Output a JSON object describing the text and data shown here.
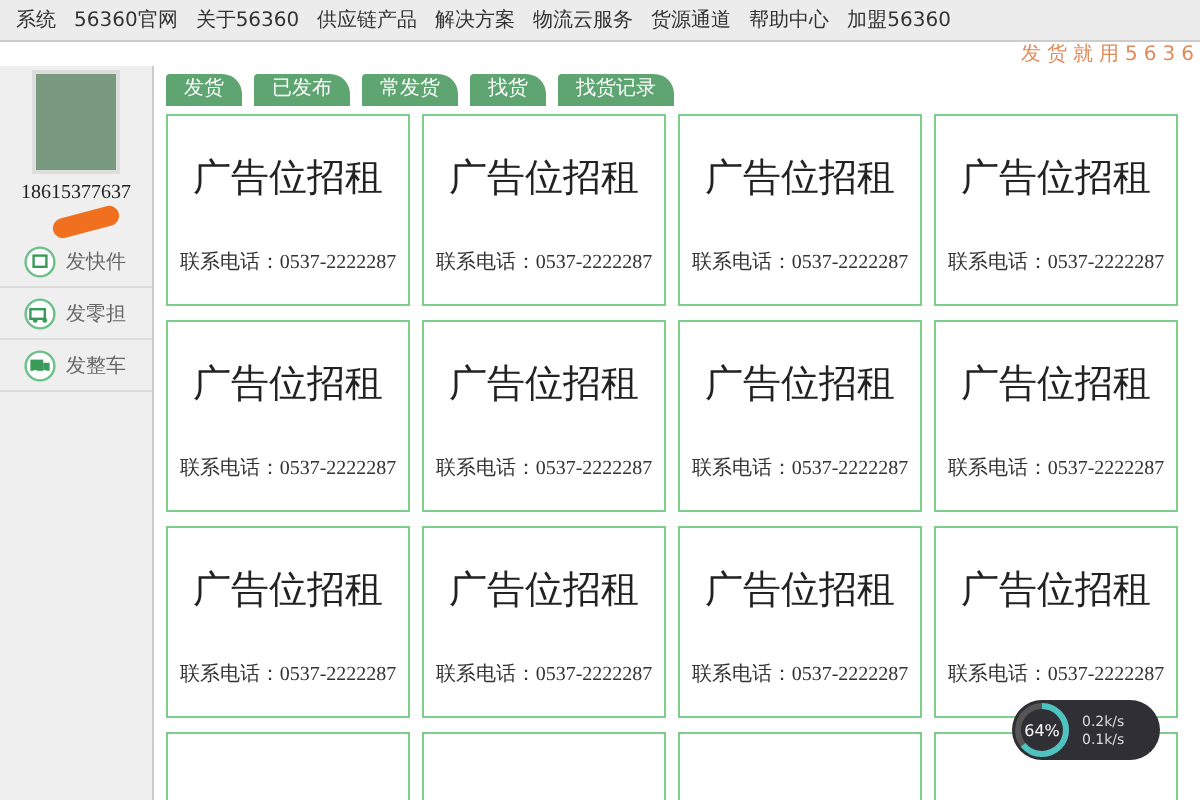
{
  "top_nav": [
    "系统",
    "56360官网",
    "关于56360",
    "供应链产品",
    "解决方案",
    "物流云服务",
    "货源通道",
    "帮助中心",
    "加盟56360"
  ],
  "slogan": "发货就用5636",
  "sidebar": {
    "phone": "18615377637",
    "items": [
      {
        "label": "发快件"
      },
      {
        "label": "发零担"
      },
      {
        "label": "发整车"
      }
    ]
  },
  "tabs": [
    {
      "label": "发货",
      "selected": false
    },
    {
      "label": "已发布",
      "selected": false
    },
    {
      "label": "常发货",
      "selected": false
    },
    {
      "label": "找货",
      "selected": false
    },
    {
      "label": "找货记录",
      "selected": false
    }
  ],
  "cards": [
    {
      "title": "广告位招租",
      "contact": "联系电话：0537-2222287"
    },
    {
      "title": "广告位招租",
      "contact": "联系电话：0537-2222287"
    },
    {
      "title": "广告位招租",
      "contact": "联系电话：0537-2222287"
    },
    {
      "title": "广告位招租",
      "contact": "联系电话：0537-2222287"
    },
    {
      "title": "广告位招租",
      "contact": "联系电话：0537-2222287"
    },
    {
      "title": "广告位招租",
      "contact": "联系电话：0537-2222287"
    },
    {
      "title": "广告位招租",
      "contact": "联系电话：0537-2222287"
    },
    {
      "title": "广告位招租",
      "contact": "联系电话：0537-2222287"
    },
    {
      "title": "广告位招租",
      "contact": "联系电话：0537-2222287"
    },
    {
      "title": "广告位招租",
      "contact": "联系电话：0537-2222287"
    },
    {
      "title": "广告位招租",
      "contact": "联系电话：0537-2222287"
    },
    {
      "title": "广告位招租",
      "contact": "联系电话：0537-2222287"
    }
  ],
  "speed_widget": {
    "percent": "64%",
    "level": 0.64,
    "upload": "0.2k/s",
    "download": "0.1k/s"
  }
}
